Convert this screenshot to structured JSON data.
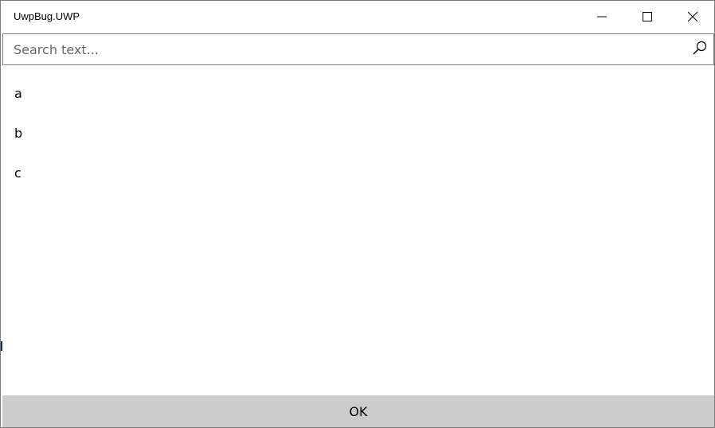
{
  "window": {
    "title": "UwpBug.UWP"
  },
  "caption_buttons": {
    "minimize_icon": "minimize-icon",
    "maximize_icon": "maximize-icon",
    "close_icon": "close-icon"
  },
  "search": {
    "placeholder": "Search text...",
    "value": "",
    "button_icon": "search-icon"
  },
  "list": {
    "items": [
      {
        "label": "a"
      },
      {
        "label": "b"
      },
      {
        "label": "c"
      }
    ]
  },
  "footer": {
    "ok_label": "OK"
  },
  "colors": {
    "footer_background": "#cccccc",
    "border": "#7a7a7a",
    "background": "#ffffff"
  }
}
